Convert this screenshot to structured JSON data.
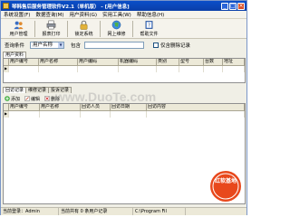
{
  "window": {
    "title": "琴韩售后服务管理软件V2.1（单机版） - [用户信息]",
    "controls": [
      "minimize-icon",
      "maximize-icon",
      "close-icon"
    ]
  },
  "menubar": {
    "items": [
      "系统设置(F)",
      "数据查询(M)",
      "用户资料(G)",
      "实用工具(W)",
      "帮助信息(H)"
    ]
  },
  "toolbar": {
    "buttons": [
      {
        "label": "用户管理",
        "icon": "users-icon"
      },
      {
        "label": "报表打印",
        "icon": "printer-icon"
      },
      {
        "label": "锁定系统",
        "icon": "lock-icon"
      },
      {
        "label": "网上维修",
        "icon": "globe-icon"
      },
      {
        "label": "帮助文件",
        "icon": "help-book-icon"
      }
    ]
  },
  "filter": {
    "search_label": "查询条件",
    "field_value": "用户名称",
    "contains_label": "包含",
    "keyword_value": "",
    "checkbox_label": "仅含删除记录",
    "checked": false
  },
  "top_tabs": [
    "用户资料"
  ],
  "user_grid": {
    "columns": [
      "用户编号",
      "用户名称",
      "用户编码",
      "机器编码",
      "类别",
      "型号",
      "台数",
      "地址"
    ],
    "rows": []
  },
  "detail_tabs": [
    "回访记录",
    "维修记录",
    "投诉记录"
  ],
  "detail_toolbar": {
    "buttons": [
      {
        "label": "添加",
        "icon": "add-icon"
      },
      {
        "label": "编辑",
        "icon": "edit-icon"
      },
      {
        "label": "删除",
        "icon": "delete-icon"
      }
    ]
  },
  "detail_grid": {
    "columns": [
      "用户编号",
      "用户名称",
      "回访人员",
      "回访日期",
      "回访内容"
    ],
    "rows": []
  },
  "statusbar": {
    "user": "当前登录：Admin",
    "count": "当前共有 0 条用户记录",
    "path": "C:\\Program Fil"
  },
  "watermark_text": "www.DuoTe.com",
  "logo_text": "红软基地",
  "colors": {
    "titlebar": "#0a4fc9",
    "logo": "#e8481c"
  }
}
